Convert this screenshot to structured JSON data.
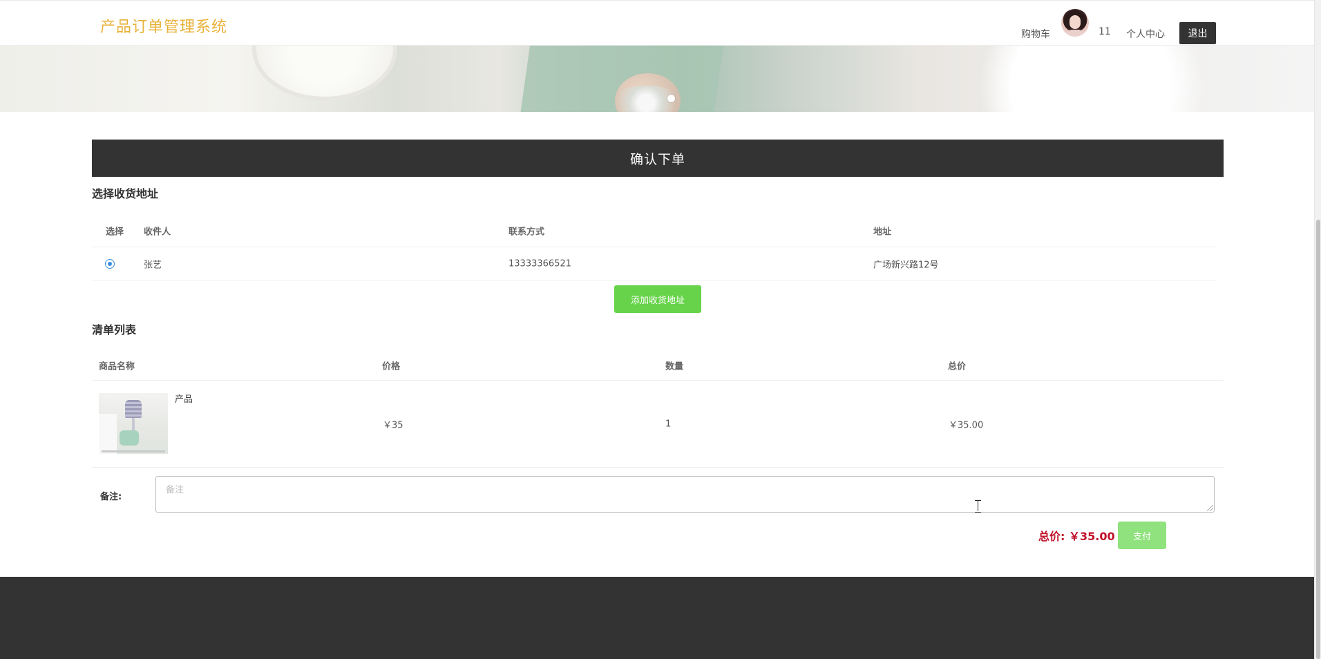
{
  "header": {
    "brand": "产品订单管理系统",
    "cart_label": "购物车",
    "username": "11",
    "profile_label": "个人中心",
    "logout_label": "退出"
  },
  "page_title": "确认下单",
  "address_section": {
    "title": "选择收货地址",
    "columns": [
      "选择",
      "收件人",
      "联系方式",
      "地址"
    ],
    "rows": [
      {
        "selected": true,
        "recipient": "张艺",
        "phone": "13333366521",
        "address": "广场新兴路12号"
      }
    ],
    "add_button_label": "添加收货地址"
  },
  "items_section": {
    "title": "清单列表",
    "columns": [
      "商品名称",
      "价格",
      "数量",
      "总价"
    ],
    "rows": [
      {
        "name": "产品",
        "price": "￥35",
        "quantity": "1",
        "subtotal": "￥35.00"
      }
    ]
  },
  "remark": {
    "label": "备注:",
    "placeholder": "备注",
    "value": ""
  },
  "summary": {
    "total_label": "总价: ￥35.00",
    "pay_button_label": "支付"
  },
  "colors": {
    "brand": "#e8b23a",
    "title_bar": "#333333",
    "add_button": "#67d34a",
    "pay_button": "#8fe27d",
    "total_text": "#c0102a",
    "footer": "#333333"
  }
}
